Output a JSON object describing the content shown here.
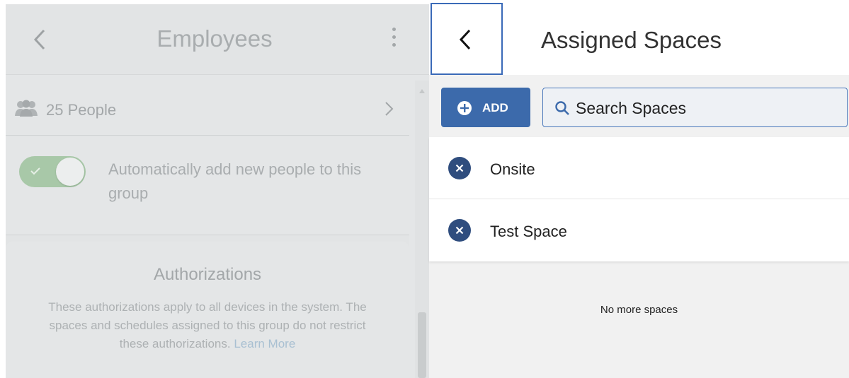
{
  "left_panel": {
    "title": "Employees",
    "people_count": "25 People",
    "auto_add_label": "Automatically add new people to this group",
    "auto_add_enabled": true,
    "authorizations": {
      "title": "Authorizations",
      "description": "These authorizations apply to all devices in the system. The spaces and schedules assigned to this group do not restrict these authorizations.",
      "link": "Learn More"
    }
  },
  "right_panel": {
    "title": "Assigned Spaces",
    "add_label": "ADD",
    "search_placeholder": "Search Spaces",
    "spaces": [
      {
        "name": "Onsite"
      },
      {
        "name": "Test Space"
      }
    ],
    "empty_message": "No more spaces"
  },
  "colors": {
    "accent": "#3c6aab",
    "toggle_on": "#a8c8a8"
  }
}
